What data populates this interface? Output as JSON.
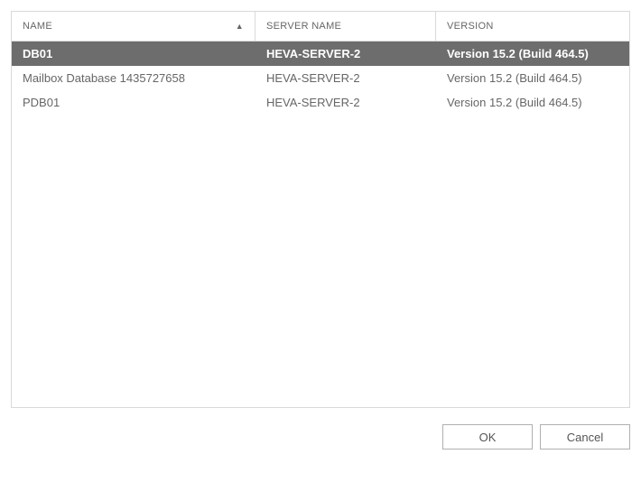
{
  "columns": {
    "name": "NAME",
    "server": "SERVER NAME",
    "version": "VERSION"
  },
  "sort": {
    "column": "name",
    "direction": "asc"
  },
  "rows": [
    {
      "name": "DB01",
      "server": "HEVA-SERVER-2",
      "version": "Version 15.2 (Build 464.5)",
      "selected": true
    },
    {
      "name": "Mailbox Database 1435727658",
      "server": "HEVA-SERVER-2",
      "version": "Version 15.2 (Build 464.5)",
      "selected": false
    },
    {
      "name": "PDB01",
      "server": "HEVA-SERVER-2",
      "version": "Version 15.2 (Build 464.5)",
      "selected": false
    }
  ],
  "buttons": {
    "ok": "OK",
    "cancel": "Cancel"
  }
}
